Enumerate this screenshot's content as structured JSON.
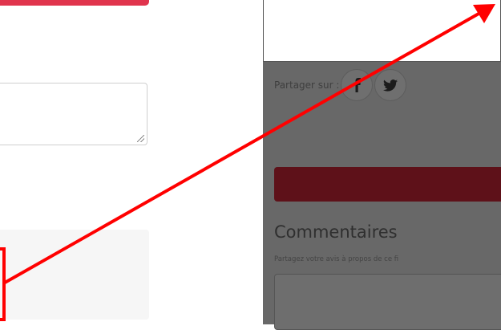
{
  "share": {
    "label": "Partager sur :",
    "facebook_icon": "facebook-icon",
    "twitter_icon": "twitter-icon"
  },
  "comments": {
    "title": "Commentaires",
    "subtitle": "Partagez votre avis à propos de ce fi"
  },
  "colors": {
    "accent_red": "#e0344d",
    "annotation_red": "#ff0000",
    "overlay_grey": "#686868",
    "dark_red_button": "#5e1119"
  }
}
